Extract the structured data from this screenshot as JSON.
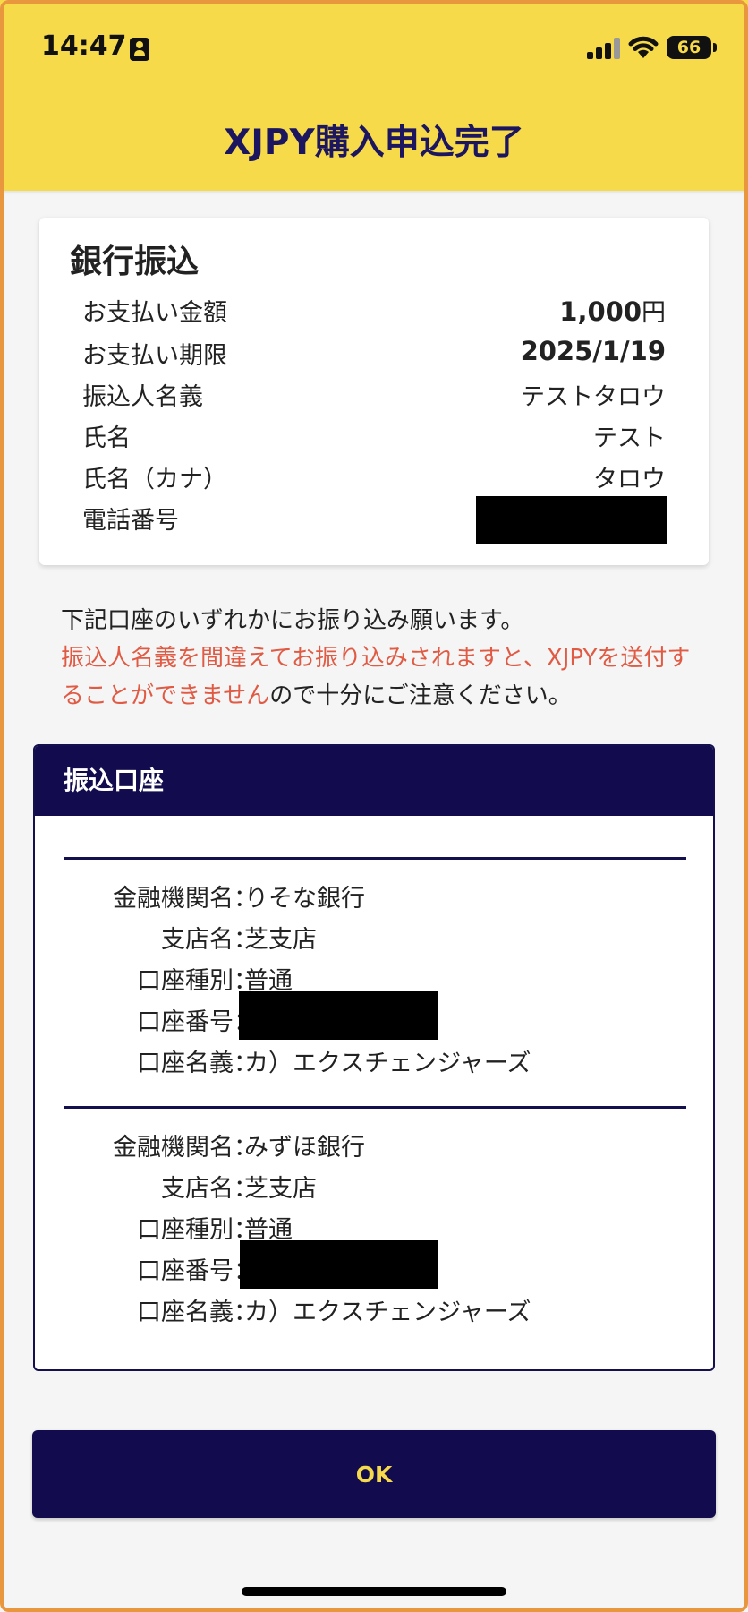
{
  "status_bar": {
    "time": "14:47",
    "battery": "66",
    "icons": [
      "person-badge-icon",
      "cellular-signal-icon",
      "wifi-icon",
      "battery-icon"
    ]
  },
  "header": {
    "title": "XJPY購入申込完了"
  },
  "payment": {
    "title": "銀行振込",
    "rows": [
      {
        "label": "お支払い金額",
        "value_num": "1,000",
        "value_unit": "円"
      },
      {
        "label": "お支払い期限",
        "value": "2025/1/19"
      },
      {
        "label": "振込人名義",
        "value": "テストタロウ"
      },
      {
        "label": "氏名",
        "value": "テスト"
      },
      {
        "label": "氏名（カナ）",
        "value": "タロウ"
      },
      {
        "label": "電話番号",
        "value": ""
      }
    ]
  },
  "notice": {
    "line1": "下記口座のいずれかにお振り込み願います。",
    "warn": "振込人名義を間違えてお振り込みされますと、XJPYを送付することができません",
    "tail": "ので十分にご注意ください。"
  },
  "accounts": {
    "title": "振込口座",
    "banks": [
      {
        "bank_label": "金融機関名：",
        "bank": "りそな銀行",
        "branch_label": "支店名：",
        "branch": "芝支店",
        "type_label": "口座種別：",
        "type": "普通",
        "number_label": "口座番号：",
        "holder_label": "口座名義：",
        "holder": "カ）エクスチェンジャーズ"
      },
      {
        "bank_label": "金融機関名：",
        "bank": "みずほ銀行",
        "branch_label": "支店名：",
        "branch": "芝支店",
        "type_label": "口座種別：",
        "type": "普通",
        "number_label": "口座番号：",
        "holder_label": "口座名義：",
        "holder": "カ）エクスチェンジャーズ"
      }
    ]
  },
  "ok_button": {
    "label": "OK"
  },
  "colors": {
    "header_bg": "#f6da4a",
    "title_navy": "#1c1660",
    "navy": "#120c4f",
    "warning_red": "#e05a44",
    "button_text": "#f6da4a"
  }
}
